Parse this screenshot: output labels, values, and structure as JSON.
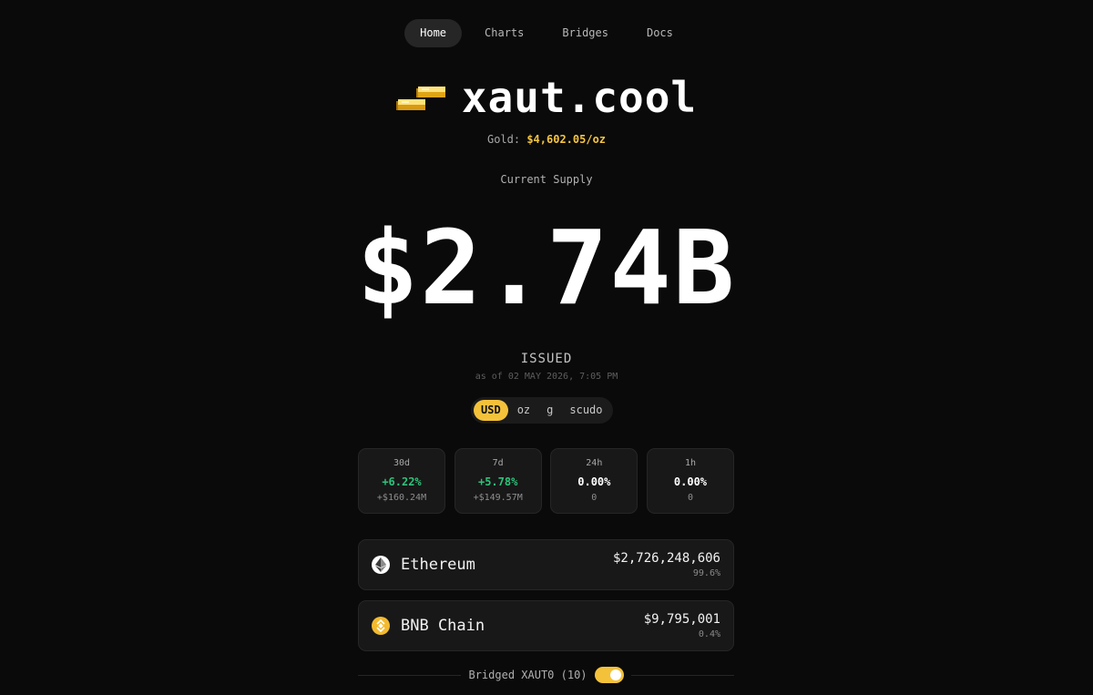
{
  "nav": [
    {
      "label": "Home",
      "active": true
    },
    {
      "label": "Charts",
      "active": false
    },
    {
      "label": "Bridges",
      "active": false
    },
    {
      "label": "Docs",
      "active": false
    }
  ],
  "logo": {
    "title": "xaut.cool",
    "icon": "gold-bars-icon"
  },
  "gold": {
    "label": "Gold:",
    "value": "$4,602.05/oz"
  },
  "supply": {
    "label": "Current Supply",
    "value": "$2.74B",
    "status": "ISSUED",
    "as_of": "as of 02 MAY 2026, 7:05 PM"
  },
  "units": [
    {
      "label": "USD",
      "active": true
    },
    {
      "label": "oz",
      "active": false
    },
    {
      "label": "g",
      "active": false
    },
    {
      "label": "scudo",
      "active": false
    }
  ],
  "stats": [
    {
      "period": "30d",
      "pct": "+6.22%",
      "abs": "+$160.24M",
      "trend": "up"
    },
    {
      "period": "7d",
      "pct": "+5.78%",
      "abs": "+$149.57M",
      "trend": "up"
    },
    {
      "period": "24h",
      "pct": "0.00%",
      "abs": "0",
      "trend": "flat"
    },
    {
      "period": "1h",
      "pct": "0.00%",
      "abs": "0",
      "trend": "flat"
    }
  ],
  "chains": [
    {
      "name": "Ethereum",
      "amount": "$2,726,248,606",
      "share": "99.6%",
      "icon": "ethereum-icon",
      "icon_bg": "#ffffff"
    },
    {
      "name": "BNB Chain",
      "amount": "$9,795,001",
      "share": "0.4%",
      "icon": "bnb-icon",
      "icon_bg": "#f3ba2f"
    }
  ],
  "bridged": {
    "label": "Bridged XAUT0 (10)",
    "enabled": true
  },
  "colors": {
    "accent": "#f4c23a",
    "positive": "#2fc27a",
    "background": "#0a0a0a",
    "card": "#181818"
  }
}
